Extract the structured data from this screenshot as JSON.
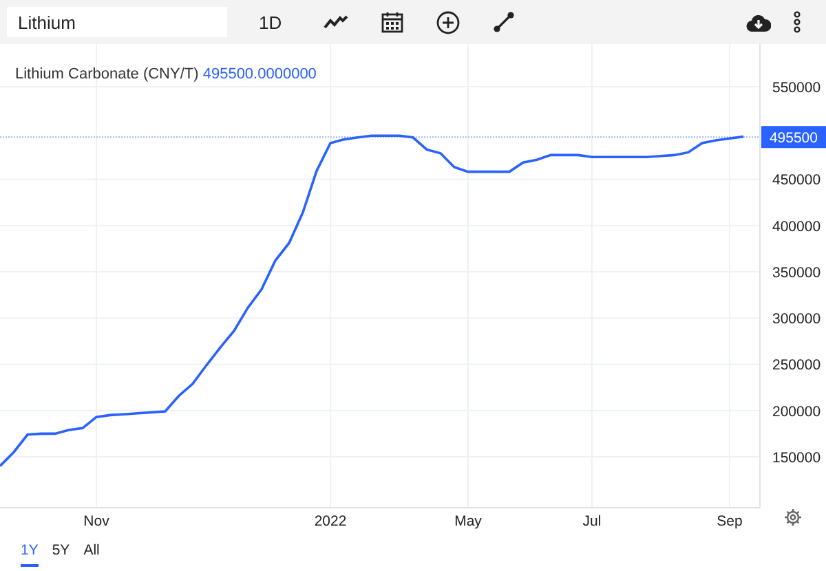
{
  "toolbar": {
    "search": {
      "value": "Lithium"
    },
    "interval": "1D"
  },
  "legend": {
    "name": "Lithium Carbonate (CNY/T)",
    "value": "495500.0000000"
  },
  "chart_data": {
    "type": "line",
    "grid": true,
    "ylim": [
      95000,
      596000
    ],
    "ref_lines": [
      {
        "axis": "y",
        "value": 495500,
        "label": "495500"
      }
    ],
    "categories": [
      null,
      null,
      null,
      null,
      null,
      null,
      null,
      "Nov",
      null,
      null,
      null,
      null,
      null,
      null,
      null,
      null,
      null,
      null,
      null,
      null,
      null,
      null,
      null,
      null,
      "2022",
      null,
      null,
      null,
      null,
      null,
      null,
      null,
      null,
      null,
      "May",
      null,
      null,
      null,
      null,
      null,
      null,
      null,
      null,
      "Jul",
      null,
      null,
      null,
      null,
      null,
      null,
      null,
      null,
      null,
      "Sep",
      null
    ],
    "series": [
      {
        "color": "#2962ff",
        "values": [
          140000,
          155000,
          174000,
          175000,
          175000,
          179000,
          181000,
          193000,
          195000,
          196000,
          197000,
          198000,
          199000,
          216000,
          229000,
          249000,
          268000,
          286000,
          311000,
          331000,
          362000,
          381000,
          414000,
          459000,
          489000,
          493000,
          495000,
          497000,
          497000,
          497000,
          495000,
          482000,
          478000,
          463000,
          458000,
          458000,
          458000,
          458000,
          468000,
          471000,
          476000,
          476000,
          476000,
          474000,
          474000,
          474000,
          474000,
          474000,
          475000,
          476000,
          479000,
          489000,
          492000,
          494000,
          496000
        ]
      }
    ],
    "yticks": [
      {
        "value": 150000,
        "label": "150000"
      },
      {
        "value": 200000,
        "label": "200000"
      },
      {
        "value": 250000,
        "label": "250000"
      },
      {
        "value": 300000,
        "label": "300000"
      },
      {
        "value": 350000,
        "label": "350000"
      },
      {
        "value": 400000,
        "label": "400000"
      },
      {
        "value": 450000,
        "label": "450000"
      },
      {
        "value": 550000,
        "label": "550000"
      }
    ]
  },
  "ranges": [
    {
      "label": "1Y",
      "selected": true
    },
    {
      "label": "5Y",
      "selected": false
    },
    {
      "label": "All",
      "selected": false
    }
  ]
}
